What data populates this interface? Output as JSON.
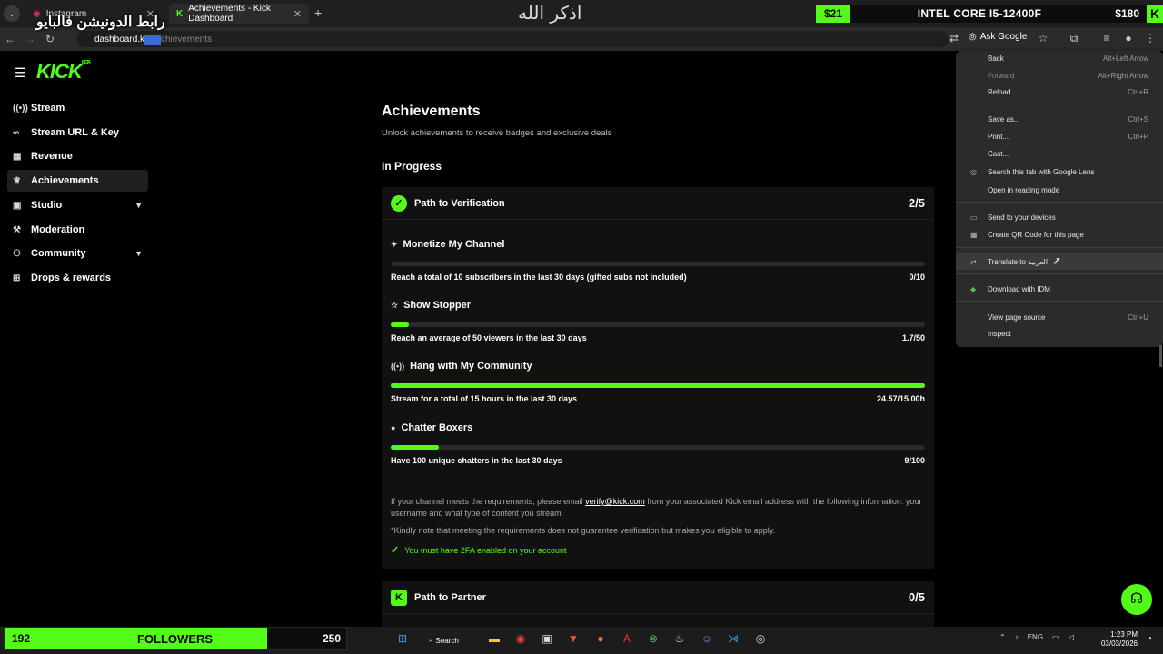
{
  "browser": {
    "tabs": [
      {
        "label": "Instagram"
      },
      {
        "label": "Achievements - Kick Dashboard"
      }
    ],
    "url_selected": "dashboard.k",
    "url_rest": "chievements",
    "ask_google": "Ask Google"
  },
  "overlay": {
    "arabic_link": "رابط الدونيشن فالبايو",
    "athkar": "اذكر الله",
    "cpu_left_price": "$21",
    "cpu_name": "INTEL CORE I5-12400F",
    "cpu_right_price": "$180",
    "kick_mark": "K",
    "followers_current": "192",
    "followers_label": "FOLLOWERS",
    "followers_goal": "250",
    "followers_progress": 0.768
  },
  "sidebar": {
    "logo": "KICK",
    "logo_tag": "BETA",
    "items": [
      {
        "label": "Stream",
        "icon": "stream-icon"
      },
      {
        "label": "Stream URL & Key",
        "icon": "link-icon"
      },
      {
        "label": "Revenue",
        "icon": "chart-icon"
      },
      {
        "label": "Achievements",
        "icon": "trophy-icon"
      },
      {
        "label": "Studio",
        "icon": "grid-icon"
      },
      {
        "label": "Moderation",
        "icon": "hammer-icon"
      },
      {
        "label": "Community",
        "icon": "people-icon"
      },
      {
        "label": "Drops & rewards",
        "icon": "gift-icon"
      }
    ]
  },
  "main": {
    "title": "Achievements",
    "subtitle": "Unlock achievements to receive badges and exclusive deals",
    "section": "In Progress",
    "card1": {
      "title": "Path to Verification",
      "count": "2/5"
    },
    "achievements": [
      {
        "title": "Monetize My Channel",
        "desc": "Reach a total of 10 subscribers in the last 30 days (gifted subs not included)",
        "value": "0/10",
        "progress": 0.0
      },
      {
        "title": "Show Stopper",
        "desc": "Reach an average of 50 viewers in the last 30 days",
        "value": "1.7/50",
        "progress": 0.034
      },
      {
        "title": "Hang with My Community",
        "desc": "Stream for a total of 15 hours in the last 30 days",
        "value": "24.57/15.00h",
        "progress": 1.0
      },
      {
        "title": "Chatter Boxers",
        "desc": "Have 100 unique chatters in the last 30 days",
        "value": "9/100",
        "progress": 0.09
      }
    ],
    "info_pre": "If your channel meets the requirements, please email ",
    "info_email": "verify@kick.com",
    "info_post": " from your associated Kick email address with the following information: your username and what type of content you stream.",
    "info_note": "*Kindly note that meeting the requirements does not guarantee verification but makes you eligible to apply.",
    "info_2fa": "You must have 2FA enabled on your account",
    "card2": {
      "title": "Path to Partner",
      "count": "0/5"
    }
  },
  "context_menu": [
    {
      "label": "Back",
      "shortcut": "Alt+Left Arrow"
    },
    {
      "label": "Forward",
      "shortcut": "Alt+Right Arrow"
    },
    {
      "label": "Reload",
      "shortcut": "Ctrl+R"
    },
    {
      "label": "Save as...",
      "shortcut": "Ctrl+S"
    },
    {
      "label": "Print...",
      "shortcut": "Ctrl+P"
    },
    {
      "label": "Cast...",
      "shortcut": ""
    },
    {
      "label": "Search this tab with Google Lens",
      "shortcut": ""
    },
    {
      "label": "Open in reading mode",
      "shortcut": ""
    },
    {
      "label": "Send to your devices",
      "shortcut": ""
    },
    {
      "label": "Create QR Code for this page",
      "shortcut": ""
    },
    {
      "label": "Translate to العربية",
      "shortcut": ""
    },
    {
      "label": "Download with IDM",
      "shortcut": ""
    },
    {
      "label": "View page source",
      "shortcut": "Ctrl+U"
    },
    {
      "label": "Inspect",
      "shortcut": ""
    }
  ],
  "taskbar": {
    "search": "Search",
    "lang": "ENG",
    "time": "1:23 PM",
    "date": "03/03/2026"
  }
}
